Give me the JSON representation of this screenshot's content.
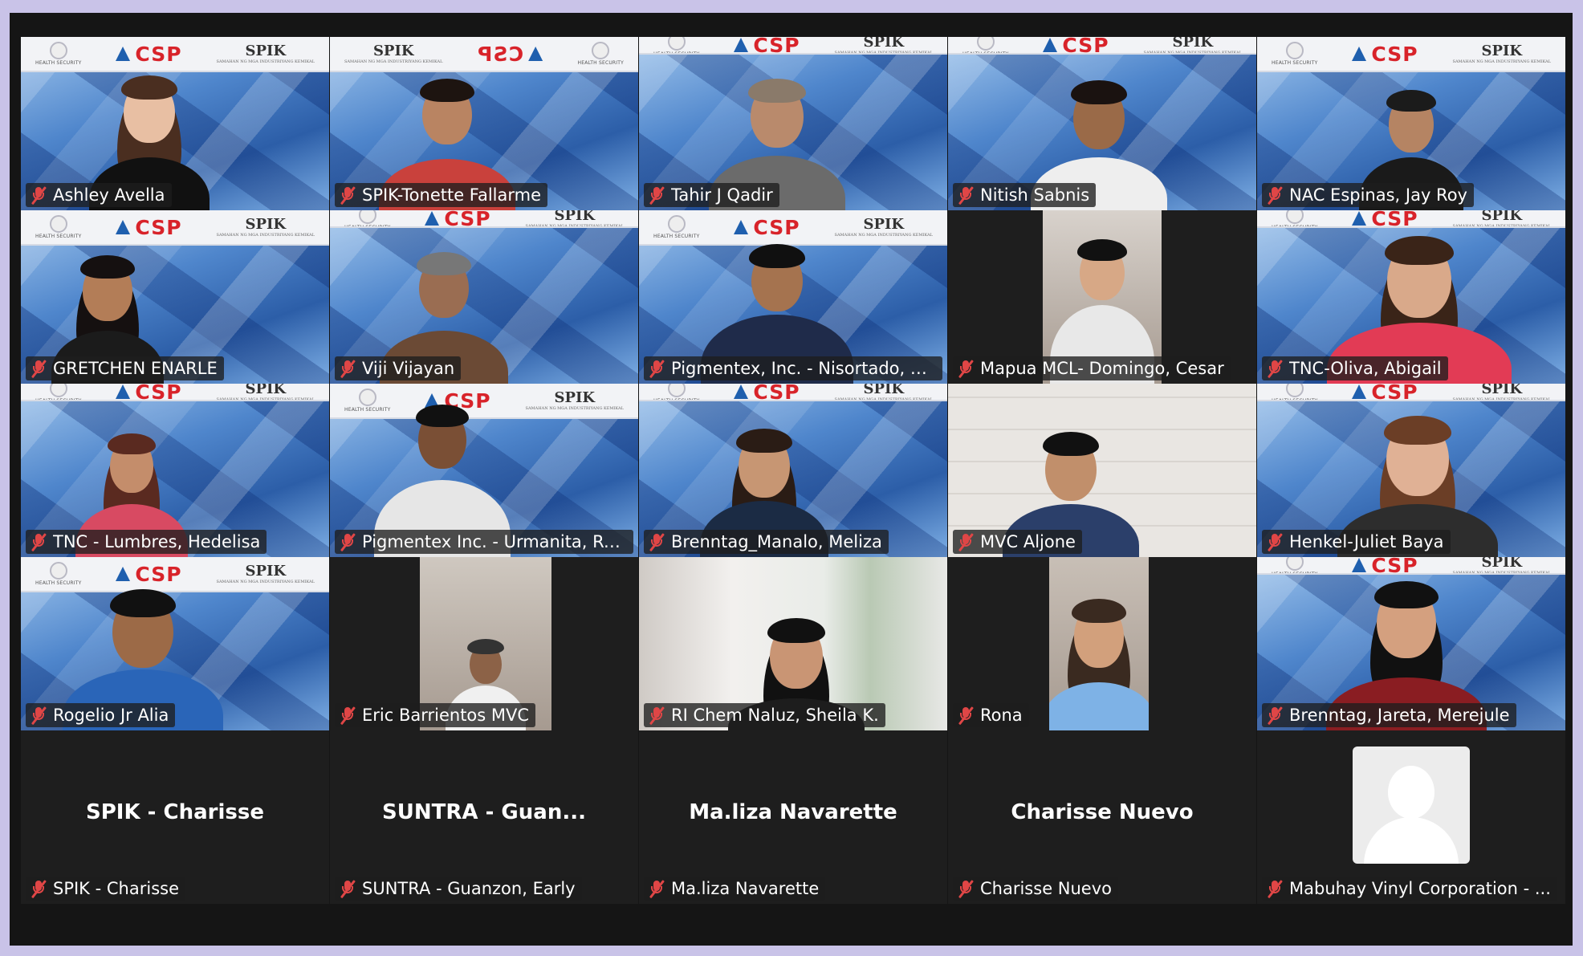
{
  "meeting": {
    "participants": [
      {
        "name": "Ashley Avella"
      },
      {
        "name": "SPIK-Tonette Fallarme"
      },
      {
        "name": "Tahir J Qadir"
      },
      {
        "name": "Nitish Sabnis"
      },
      {
        "name": "NAC Espinas, Jay Roy"
      },
      {
        "name": "GRETCHEN ENARLE"
      },
      {
        "name": "Viji Vijayan"
      },
      {
        "name": "Pigmentex, Inc. - Nisortado, R..."
      },
      {
        "name": "Mapua MCL- Domingo, Cesar"
      },
      {
        "name": "TNC-Oliva, Abigail"
      },
      {
        "name": "TNC - Lumbres, Hedelisa"
      },
      {
        "name": "Pigmentex Inc. - Urmanita, Ro..."
      },
      {
        "name": "Brenntag_Manalo, Meliza"
      },
      {
        "name": "MVC Aljone"
      },
      {
        "name": "Henkel-Juliet Baya"
      },
      {
        "name": "Rogelio Jr Alia"
      },
      {
        "name": "Eric Barrientos MVC"
      },
      {
        "name": "RI Chem Naluz, Sheila K."
      },
      {
        "name": "Rona"
      },
      {
        "name": "Brenntag, Jareta, Merejule"
      },
      {
        "name": "SPIK - Charisse",
        "display": "SPIK - Charisse"
      },
      {
        "name": "SUNTRA - Guanzon, Early",
        "display": "SUNTRA - Guan..."
      },
      {
        "name": "Ma.liza Navarette",
        "display": "Ma.liza Navarette"
      },
      {
        "name": "Charisse Nuevo",
        "display": "Charisse Nuevo"
      },
      {
        "name": "Mabuhay Vinyl Corporation - ..."
      }
    ]
  },
  "background": {
    "brand": "CSP",
    "partner": "SPIK",
    "partner_sub": "SAMAHAN NG MGA INDUSTRIYANG KEMIKAL",
    "left_caption": "HEALTH SECURITY",
    "mirrored_left": "SPIK",
    "mirrored_brand": "CSP",
    "mirrored_right": "HEALTH SECURITY"
  },
  "colors": {
    "active_speaker": "#3fd67a",
    "mute": "#e04646",
    "brand_red": "#d8232a",
    "brand_blue": "#1f5fae"
  },
  "icons": {
    "mute": "mic-muted-icon",
    "avatar": "default-avatar-icon",
    "flask": "flask-logo-icon"
  }
}
